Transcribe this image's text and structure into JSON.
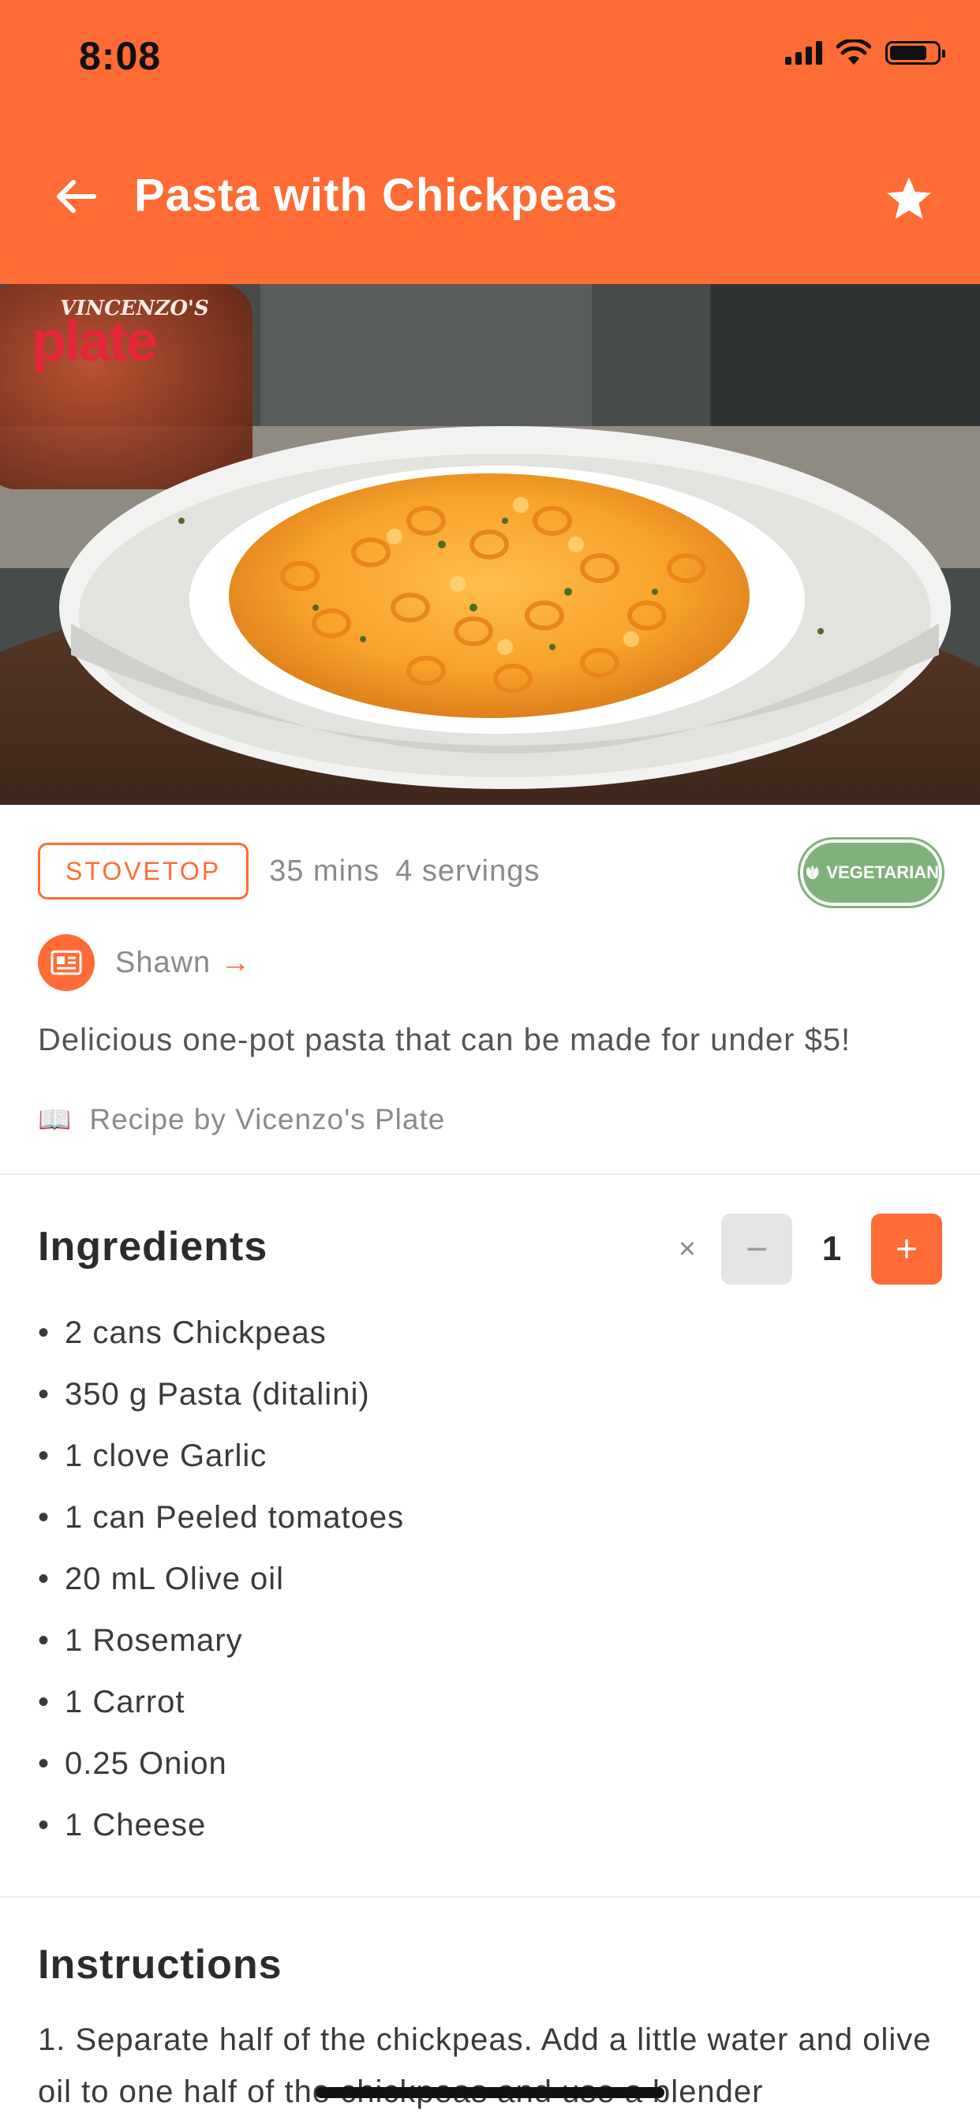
{
  "status_bar": {
    "time": "8:08"
  },
  "nav": {
    "title": "Pasta with Chickpeas",
    "back_icon": "arrow-left-icon",
    "favorite_icon": "star-icon"
  },
  "hero": {
    "logo_top": "VINCENZO'S",
    "logo_main": "plate"
  },
  "meta": {
    "method": "STOVETOP",
    "time": "35 mins",
    "servings": "4 servings",
    "diet_badge": "VEGETARIAN"
  },
  "author": {
    "name": "Shawn",
    "arrow": "→"
  },
  "description": "Delicious one-pot pasta that can be made for under $5!",
  "source": {
    "icon": "📖",
    "text": "Recipe by Vicenzo's Plate"
  },
  "ingredients": {
    "title": "Ingredients",
    "multiplier_symbol": "×",
    "minus_label": "−",
    "plus_label": "+",
    "scale": "1",
    "items": [
      "2 cans Chickpeas",
      "350 g Pasta (ditalini)",
      "1 clove Garlic",
      "1 can Peeled tomatoes",
      "20 mL Olive oil",
      "1 Rosemary",
      "1 Carrot",
      "0.25 Onion",
      "1 Cheese"
    ]
  },
  "instructions": {
    "title": "Instructions",
    "step_1": "1. Separate half of the chickpeas. Add a little water and olive oil to one half of the chickpeas and use a blender"
  },
  "colors": {
    "accent": "#ff6b35",
    "vegetarian": "#7fb27b",
    "muted_text": "#8a8a8a"
  }
}
